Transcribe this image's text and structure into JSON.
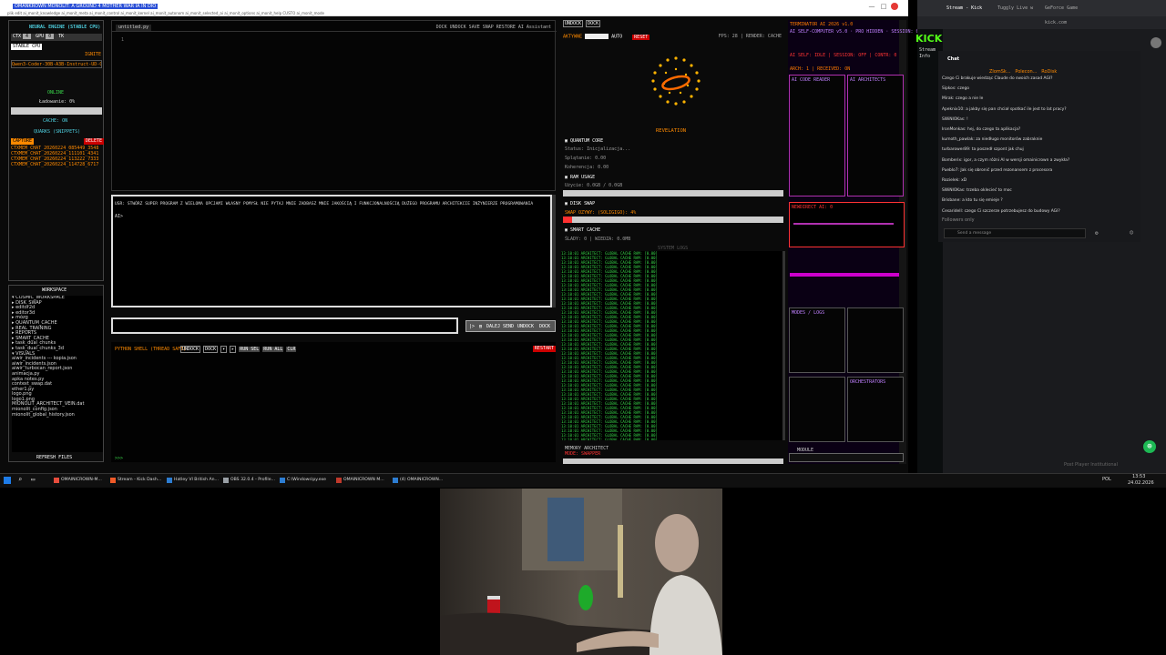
{
  "window": {
    "title": "OMANKROWN MONOLIT: A GROUND 4 MOTHER WAR IA IN DIO",
    "menu": "plik  edit  ai_monit_knowledge  ai_monit_meta  ai_monit_control  ai_monit_kernel  ai_monit_autonom  ai_monit_selected_ai  ai_monit_options  ai_monit_help  CUSTO  ai_monit_mode",
    "controls": [
      "—",
      "□",
      "×"
    ]
  },
  "left_panel": {
    "engine": "NEURAL ENGINE (STABLE CPU)",
    "ctx_labels": [
      "CTX",
      "GPU",
      "TK"
    ],
    "model_tag": "IGNITE",
    "model_name": "Qwen3-Coder-30B-A3B-Instruct-UD-Q8_",
    "status_online": "ONLINE",
    "loading": "Ładowanie: 0%",
    "cache_on": "CACHE: ON",
    "quarks": "QUARKS (SNIPPETS)",
    "capture_btn": "CAPTURE",
    "delete_btn": "DELETE",
    "snippets": [
      "CTXMEM_CHAT_20260224_085449_3548",
      "CTXMEM_CHAT_20260224_111101_4341",
      "CTXMEM_CHAT_20260224_113222_7333",
      "CTXMEM_CHAT_20260224_114728_6717"
    ]
  },
  "workspace": {
    "title": "WORKSPACE",
    "items": [
      "▾ COSMIC_WORKSPACE",
      "  ▸ DISK_SWAP",
      "  ▸ editor2d",
      "  ▸ editor3d",
      "  ▸ mózg",
      "  ▸ QUANTUM_CACHE",
      "  ▸ REAL_TRAINING",
      "  ▸ REPORTS",
      "  ▸ SMART_CACHE",
      "  ▸ task_dual_chunks",
      "  ▸ task_dual_chunks_3d",
      "  ▾ VISUALS",
      "      aiwir_incidents --- kopia.json",
      "      aiwir_incidents.json",
      "      aiwir_turbocan_report.json",
      "      animacja.py",
      "      apka notes.py",
      "      context_swap.dat",
      "      ether1.py",
      "      logo.png",
      "      logo1.png",
      "      MIONOLIT_ARCHITECT_VEIN.dat",
      "      mionolit_config.json",
      "      mionolit_global_history.json"
    ],
    "refresh": "REFRESH FILES"
  },
  "editor": {
    "tab": "untitled.py",
    "toolbar": "DOCK  UNDOCK  SAVE  SNAP  RESTORE  AI Assistant",
    "line_no": "1"
  },
  "prompt": {
    "text": "USR: STWÓRZ SUPER PROGRAM Z WIELOMA OPCJAMI WŁASNY POMYSŁ NIE PYTAJ MNIE ZADBASZ MNIE JAKOŚCIĄ I FUNKCJONALNOŚCIĄ DUŻEGO PROGRAMU ARCHITEKCIE INŻYNIERZE PROGRAMOWANIA",
    "cursor": "AI>"
  },
  "send": {
    "labels": [
      "|>",
      "▤",
      "DALEJ",
      "SEND",
      "UNDOCK",
      "DOCK"
    ]
  },
  "shell": {
    "title": "PYTHON SHELL (THREAD SAFE)",
    "buttons": [
      "UNDOCK",
      "DOCK",
      "▾",
      "▸",
      "RUN SEL",
      "RUN ALL",
      "CLR"
    ],
    "restart": "RESTART",
    "prompt": ">>>"
  },
  "quantum": {
    "top_tabs": [
      "UNDOCK",
      "DOCK"
    ],
    "toolbar": [
      "AKTYWNE",
      "AUTO",
      "RESET"
    ],
    "fps": "FPS: 28  |  RENDER: CACHE",
    "revelation": "REVELATION",
    "core_title": "QUANTUM CORE",
    "core_lines": [
      "Status: Inicjalizacja...",
      "Splątanie: 0.00",
      "Koherencja: 0.00"
    ],
    "ram_title": "RAM USAGE",
    "ram_line": "Użycie: 0.0GB / 0.0GB",
    "swap_title": "DISK SWAP",
    "swap_line": "SWAP OZYWY: (SOLIGIGO): 4%",
    "smart_title": "SMART CACHE",
    "smart_line": "ŚLADY: 0 | WIEDZA: 0.0MB",
    "system_log": "SYSTEM LOGS",
    "log_line": "13:10:01  ARCHITECT: GLOBAL CACHE RAM: [0.00]",
    "log_count": 42,
    "bottom": "MEMORY ARCHITECT",
    "bottom2": "MODE: SWAPPER"
  },
  "visual": {
    "title": "TERMINATOR AI 2026 v1.0",
    "subtitle": "AI SELF-COMPUTER v5.0 · PRO HIDDEN · SESSION: 0",
    "rows": [
      "AI SELF: IDLE | SESSION: OFF | CONTR: 0",
      "ARCH: 1 | RECEIVED: ON"
    ],
    "titles": [
      "AI CODE READER",
      "AI ARCHITECTS"
    ],
    "mid": "NEWDIRECT AI: 0",
    "bot1": "MODES / LOGS",
    "bot2": "ORCHESTRATORS",
    "footer": "MODULE"
  },
  "browser": {
    "tabs": [
      "Stream - Kick",
      "Tuggly Live w",
      "GeForce Game"
    ],
    "url": "kick.com",
    "kick_logo": "KICK",
    "stream_info": "Stream Info",
    "chat_title": "Chat",
    "pinned": [
      "ZlomSk...",
      "Polecon...",
      "RoDisk"
    ],
    "messages": [
      "Czego Ci brakuje wiedząc Claude do swoich zasad AGI?",
      "Sipkos: czego",
      "Mirak: czego a nie le",
      "Apeknix10: a jakby się pan chciał spotkać ile jest to lat pracy?",
      "SWiNIOKas: !",
      "IronMonkas: hej, do czego ta aplikacja?",
      "kumoth_pawlak: za niedługo monitorów zabraknie",
      "turbarower89: ta poszedł szpont jak chuj",
      "Bomberix: igor, a czym różni AI w wersji omainicrown a zwykła?",
      "Pueblo7: Jak się obronić przed rezonansem z procesora",
      "Rozielek: xD",
      "SWiNIOKas: trzeba oklecieć to moc",
      "Brisbane: a kto tu się emieje ?",
      "Cesaridell: czego Ci szczerze potrzebujesz do budowy AGI?"
    ],
    "followers_only": "Followers only",
    "input_placeholder": "Send a message",
    "footer_text": "Post Player Institutional"
  },
  "taskbar": {
    "items": [
      {
        "label": "OMAINICROWN-M...",
        "color": "#e74c3c"
      },
      {
        "label": "Stream - Kick Dash...",
        "color": "#f05a28"
      },
      {
        "label": "Hatley VI British An...",
        "color": "#2d7dd2"
      },
      {
        "label": "OBS 32.0.4 - Profile...",
        "color": "#9aa0a6"
      },
      {
        "label": "C:\\Windows\\py.exe",
        "color": "#2d7dd2"
      },
      {
        "label": "OMAINICROWN M...",
        "color": "#c0392b"
      },
      {
        "label": "(4) OMAINICROWN...",
        "color": "#2d7dd2"
      }
    ],
    "lang": "POL",
    "time": "13:53",
    "date": "24.02.2026"
  },
  "colors": {
    "accent_green": "#39d84a",
    "accent_orange": "#ff8a00",
    "accent_cyan": "#4fd0e0",
    "magenta": "#b030b0",
    "kick_green": "#53fc18"
  }
}
